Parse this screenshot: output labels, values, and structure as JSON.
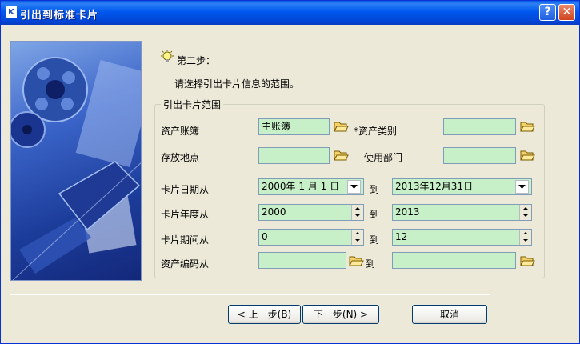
{
  "window": {
    "title": "引出到标准卡片",
    "icon": "app-logo-icon"
  },
  "titlebar": {
    "help_label": "?",
    "close_label": "✕"
  },
  "step": {
    "title": "第二步：",
    "description": "请选择引出卡片信息的范围。",
    "icon": "lightbulb-icon"
  },
  "group": {
    "legend": "引出卡片范围"
  },
  "fields": {
    "asset_book": {
      "label": "资产账簿",
      "value": "主账簿"
    },
    "asset_category": {
      "label": "*资产类别",
      "value": ""
    },
    "location": {
      "label": "存放地点",
      "value": ""
    },
    "department": {
      "label": "使用部门",
      "value": ""
    },
    "card_date": {
      "label": "卡片日期从",
      "from": "2000年 1 月 1 日",
      "to": "2013年12月31日"
    },
    "card_year": {
      "label": "卡片年度从",
      "from": "2000",
      "to": "2013"
    },
    "card_period": {
      "label": "卡片期间从",
      "from": "0",
      "to": "12"
    },
    "asset_code": {
      "label": "资产编码从",
      "from": "",
      "to": ""
    },
    "to_label": "到"
  },
  "buttons": {
    "prev": "< 上一步(B)",
    "next": "下一步(N) >",
    "cancel": "取消"
  },
  "colors": {
    "title_bar": "#0058EE",
    "field_bg": "#C8F0C8",
    "dialog_bg": "#ECE9D8"
  }
}
